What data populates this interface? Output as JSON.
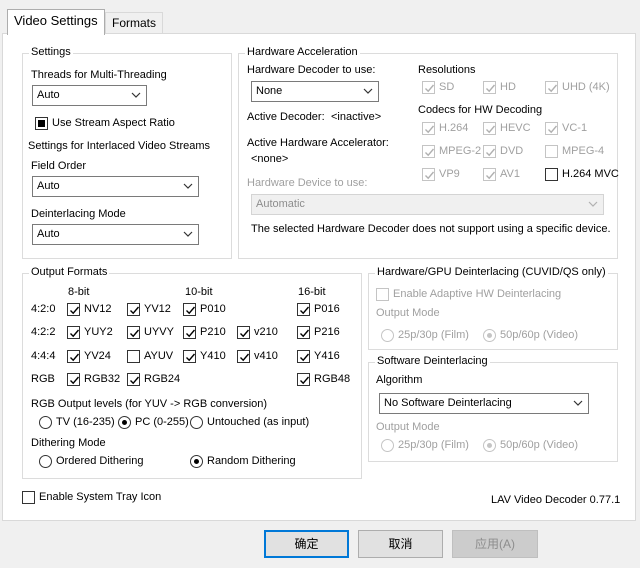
{
  "tabs": [
    {
      "label": "Video Settings"
    },
    {
      "label": "Formats"
    }
  ],
  "settings": {
    "title": "Settings",
    "threads_label": "Threads for Multi-Threading",
    "threads_value": "Auto",
    "stream_aspect": "Use Stream Aspect Ratio",
    "interlaced_title": "Settings for Interlaced Video Streams",
    "field_order_label": "Field Order",
    "field_order_value": "Auto",
    "deint_mode_label": "Deinterlacing Mode",
    "deint_mode_value": "Auto"
  },
  "hwaccel": {
    "title": "Hardware Acceleration",
    "decoder_label": "Hardware Decoder to use:",
    "decoder_value": "None",
    "active_decoder_label": "Active Decoder:",
    "active_decoder_value": "<inactive>",
    "active_accel_label": "Active Hardware Accelerator:",
    "active_accel_value": "<none>",
    "device_label": "Hardware Device to use:",
    "device_value": "Automatic",
    "note": "The selected Hardware Decoder does not support using a specific device.",
    "resolutions_title": "Resolutions",
    "res": [
      "SD",
      "HD",
      "UHD (4K)"
    ],
    "codecs_title": "Codecs for HW Decoding",
    "codecs": [
      "H.264",
      "HEVC",
      "VC-1",
      "MPEG-2",
      "DVD",
      "MPEG-4",
      "VP9",
      "AV1",
      "H.264 MVC"
    ]
  },
  "output": {
    "title": "Output Formats",
    "col_8bit": "8-bit",
    "col_10bit": "10-bit",
    "col_16bit": "16-bit",
    "row_420": "4:2:0",
    "row_422": "4:2:2",
    "row_444": "4:4:4",
    "row_rgb": "RGB",
    "nv12": "NV12",
    "yv12": "YV12",
    "p010": "P010",
    "p016": "P016",
    "yuy2": "YUY2",
    "uyvy": "UYVY",
    "p210": "P210",
    "v210": "v210",
    "p216": "P216",
    "yv24": "YV24",
    "ayuv": "AYUV",
    "y410": "Y410",
    "v410": "v410",
    "y416": "Y416",
    "rgb32": "RGB32",
    "rgb24": "RGB24",
    "rgb48": "RGB48",
    "levels_label": "RGB Output levels (for YUV -> RGB conversion)",
    "levels_tv": "TV (16-235)",
    "levels_pc": "PC (0-255)",
    "levels_untouched": "Untouched (as input)",
    "dither_label": "Dithering Mode",
    "dither_ordered": "Ordered Dithering",
    "dither_random": "Random Dithering"
  },
  "hwdeint": {
    "title": "Hardware/GPU Deinterlacing (CUVID/QS only)",
    "adaptive": "Enable Adaptive HW Deinterlacing",
    "output_mode": "Output Mode",
    "film": "25p/30p (Film)",
    "video": "50p/60p (Video)"
  },
  "swdeint": {
    "title": "Software Deinterlacing",
    "algorithm_label": "Algorithm",
    "algorithm_value": "No Software Deinterlacing",
    "output_mode": "Output Mode",
    "film": "25p/30p (Film)",
    "video": "50p/60p (Video)"
  },
  "footer": {
    "tray": "Enable System Tray Icon",
    "version": "LAV Video Decoder 0.77.1"
  },
  "buttons": {
    "ok": "确定",
    "cancel": "取消",
    "apply": "应用(A)"
  }
}
